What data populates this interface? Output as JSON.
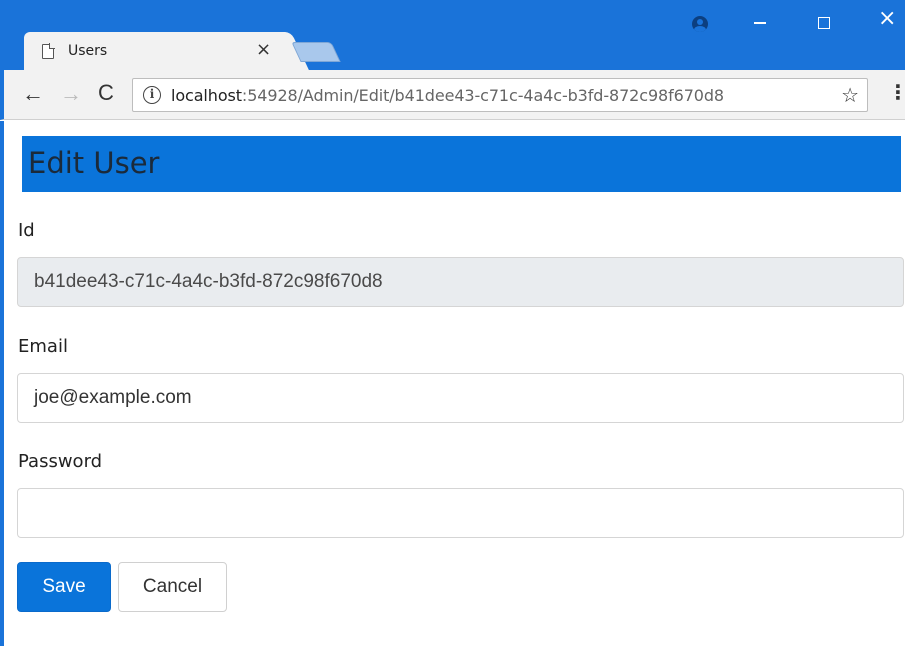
{
  "browser": {
    "tab_title": "Users",
    "tab_close": "×",
    "url_host": "localhost",
    "url_path": ":54928/Admin/Edit/b41dee43-c71c-4a4c-b3fd-872c98f670d8",
    "back": "←",
    "forward": "→",
    "reload": "C",
    "info": "i",
    "star": "☆",
    "menu": "⋮",
    "close": "×"
  },
  "page": {
    "title": "Edit User",
    "id_label": "Id",
    "id_value": "b41dee43-c71c-4a4c-b3fd-872c98f670d8",
    "email_label": "Email",
    "email_value": "joe@example.com",
    "password_label": "Password",
    "password_value": "",
    "save_label": "Save",
    "cancel_label": "Cancel"
  },
  "colors": {
    "accent": "#1a73d9",
    "heading_bg": "#0a74da",
    "readonly_bg": "#e9ecef"
  }
}
